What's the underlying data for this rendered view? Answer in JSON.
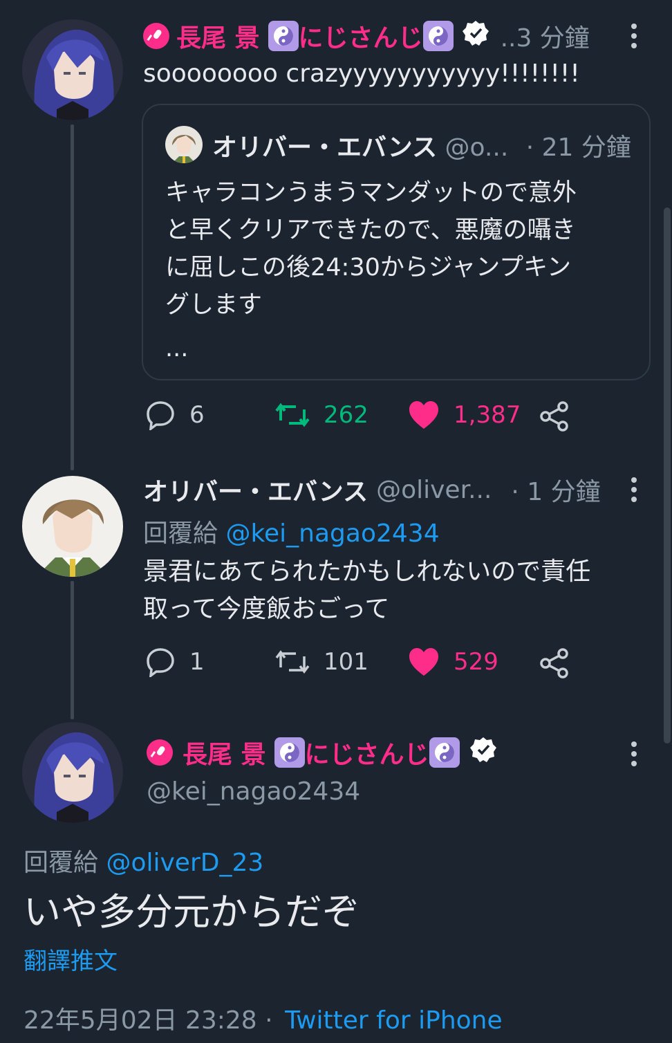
{
  "tweet1": {
    "display_name": "長尾 景",
    "group_name": "にじさんじ",
    "time": "..3 分鐘",
    "text": "soooooooo crazyyyyyyyyyyy!!!!!!!!",
    "quote": {
      "name": "オリバー・エバンス",
      "handle": "@o...",
      "time": "· 21 分鐘",
      "lines": [
        "キャラコンうまうマンダットので意外",
        "と早くクリアできたので、悪魔の囁き",
        "に屈しこの後24:30からジャンプキン",
        "グします"
      ],
      "ellipsis": "..."
    },
    "replies": "6",
    "retweets": "262",
    "likes": "1,387"
  },
  "tweet2": {
    "name": "オリバー・エバンス",
    "handle": "@oliver...",
    "time": "· 1 分鐘",
    "reply_prefix": "回覆給",
    "reply_to": "@kei_nagao2434",
    "lines": [
      "景君にあてられたかもしれないので責任",
      "取って今度飯おごって"
    ],
    "replies": "1",
    "retweets": "101",
    "likes": "529"
  },
  "tweet3": {
    "display_name": "長尾 景",
    "group_name": "にじさんじ",
    "handle": "@kei_nagao2434",
    "reply_prefix": "回覆給",
    "reply_to": "@oliverD_23",
    "text": "いや多分元からだぞ",
    "translate": "翻譯推文",
    "timestamp": "22年5月02日 23:28 ·",
    "source": "Twitter for iPhone"
  },
  "colors": {
    "background": "#1c2430",
    "pink": "#ff2d8a",
    "green": "#00ba7c",
    "blue": "#1d9bf0",
    "gray": "#8b98a5"
  }
}
